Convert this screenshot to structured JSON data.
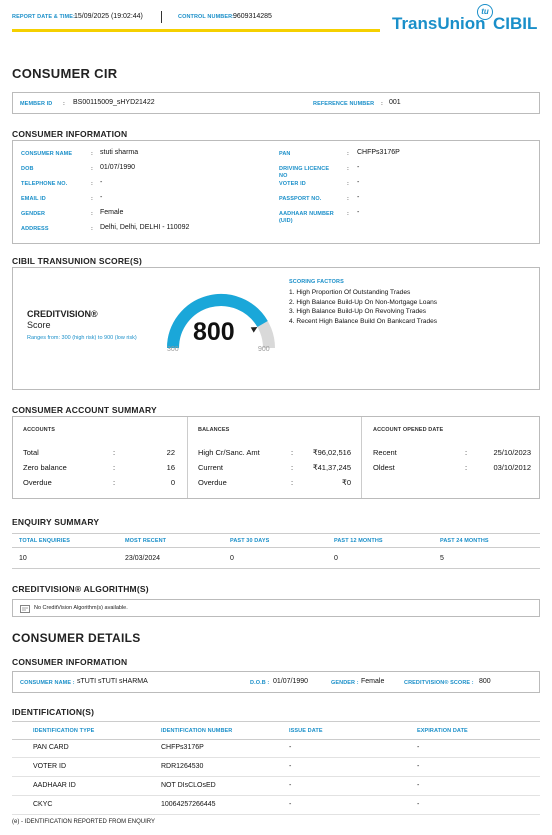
{
  "header": {
    "report_date_label": "REPORT DATE & TIME:",
    "report_date_value": "15/09/2025 (19:02:44)",
    "control_label": "CONTROL NUMBER:",
    "control_value": "9609314285",
    "brand_main": "TransUnion",
    "brand_cibil": "CIBIL",
    "brand_badge": "tu",
    "accent_yellow": "#f5d000",
    "accent_blue": "#1a8fc9"
  },
  "title": "CONSUMER CIR",
  "member": {
    "member_label": "MEMBER ID",
    "member_value": "BS00115009_sHYD21422",
    "ref_label": "REFERENCE NUMBER",
    "ref_value": "001"
  },
  "consumer_info": {
    "title": "CONSUMER INFORMATION",
    "left": [
      {
        "label": "CONSUMER NAME",
        "value": "stuti sharma"
      },
      {
        "label": "DOB",
        "value": "01/07/1990"
      },
      {
        "label": "TELEPHONE NO.",
        "value": "-"
      },
      {
        "label": "EMAIL ID",
        "value": "-"
      },
      {
        "label": "GENDER",
        "value": "Female"
      },
      {
        "label": "ADDRESS",
        "value": "Delhi, Delhi, DELHI - 110092"
      }
    ],
    "right": [
      {
        "label": "PAN",
        "value": "CHFPs3176P"
      },
      {
        "label": "DRIVING LICENCE NO",
        "value": "-"
      },
      {
        "label": "VOTER ID",
        "value": "-"
      },
      {
        "label": "PASSPORT NO.",
        "value": "-"
      },
      {
        "label": "AADHAAR NUMBER (UID)",
        "value": "-"
      }
    ]
  },
  "score_section": {
    "title": "CIBIL TRANSUNION SCORE(S)",
    "creditvision": "CREDITVISION®",
    "score_word": "Score",
    "range_text": "Ranges from: 300 (high risk) to 900 (low risk)",
    "score": "800",
    "score_value": 800,
    "min_label": "300",
    "max_label": "900",
    "scoring_factors_title": "SCORING FACTORS",
    "factors": [
      "1. High Proportion Of Outstanding Trades",
      "2. High Balance Build-Up On Non-Mortgage Loans",
      "3. High Balance Build-Up On Revolving Trades",
      "4. Recent High Balance Build On Bankcard Trades"
    ]
  },
  "account_summary": {
    "title": "CONSUMER ACCOUNT SUMMARY",
    "accounts_header": "ACCOUNTS",
    "balances_header": "BALANCES",
    "opened_header": "ACCOUNT OPENED DATE",
    "accounts": [
      {
        "label": "Total",
        "value": "22"
      },
      {
        "label": "Zero balance",
        "value": "16"
      },
      {
        "label": "Overdue",
        "value": "0"
      }
    ],
    "balances": [
      {
        "label": "High Cr/Sanc. Amt",
        "value": "₹96,02,516"
      },
      {
        "label": "Current",
        "value": "₹41,37,245"
      },
      {
        "label": "Overdue",
        "value": "₹0"
      }
    ],
    "opened": [
      {
        "label": "Recent",
        "value": "25/10/2023"
      },
      {
        "label": "Oldest",
        "value": "03/10/2012"
      }
    ]
  },
  "enquiry_summary": {
    "title": "ENQUIRY SUMMARY",
    "headers": [
      "TOTAL ENQUIRIES",
      "MOST RECENT",
      "PAST 30 DAYS",
      "PAST 12 MONTHS",
      "PAST 24 MONTHS"
    ],
    "values": [
      "10",
      "23/03/2024",
      "0",
      "0",
      "5"
    ]
  },
  "algorithm": {
    "title": "CREDITVISION® ALGORITHM(S)",
    "message": "No CreditVision Algorithm(s) available."
  },
  "consumer_details": {
    "title": "CONSUMER DETAILS",
    "info_title": "CONSUMER INFORMATION",
    "name_label": "CONSUMER NAME :",
    "name_value": "sTUTI sTUTI sHARMA",
    "dob_label": "D.O.B :",
    "dob_value": "01/07/1990",
    "gender_label": "GENDER :",
    "gender_value": "Female",
    "score_label": "CREDITVISION® SCORE :",
    "score_value": "800"
  },
  "identification": {
    "title": "IDENTIFICATION(S)",
    "headers": [
      "IDENTIFICATION TYPE",
      "IDENTIFICATION NUMBER",
      "ISSUE DATE",
      "EXPIRATION DATE"
    ],
    "rows": [
      [
        "PAN CARD",
        "CHFPs3176P",
        "-",
        "-"
      ],
      [
        "VOTER ID",
        "RDR1264530",
        "-",
        "-"
      ],
      [
        "AADHAAR ID",
        "NOT DIsCLOsED",
        "-",
        "-"
      ],
      [
        "CKYC",
        "10064257266445",
        "-",
        "-"
      ]
    ],
    "footnote": "(e) - IDENTIFICATION REPORTED FROM ENQUIRY"
  }
}
